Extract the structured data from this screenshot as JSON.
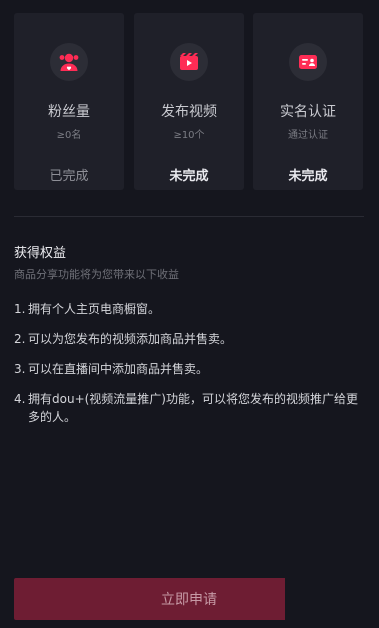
{
  "requirements": [
    {
      "title": "粉丝量",
      "sub": "≥0名",
      "status": "已完成",
      "done": true,
      "icon": "fans-icon"
    },
    {
      "title": "发布视频",
      "sub": "≥10个",
      "status": "未完成",
      "done": false,
      "icon": "video-icon"
    },
    {
      "title": "实名认证",
      "sub": "通过认证",
      "status": "未完成",
      "done": false,
      "icon": "id-card-icon"
    }
  ],
  "benefits": {
    "title": "获得权益",
    "subtitle": "商品分享功能将为您带来以下收益",
    "items": [
      {
        "num": "1.",
        "text": "拥有个人主页电商橱窗。"
      },
      {
        "num": "2.",
        "text": "可以为您发布的视频添加商品并售卖。"
      },
      {
        "num": "3.",
        "text": "可以在直播间中添加商品并售卖。"
      },
      {
        "num": "4.",
        "text": "拥有dou+(视频流量推广)功能，可以将您发布的视频推广给更多的人。"
      }
    ]
  },
  "apply_button": "立即申请",
  "colors": {
    "accent": "#fe2c55",
    "background": "#15161e",
    "card": "#1f2029",
    "button": "#6e1d33"
  }
}
